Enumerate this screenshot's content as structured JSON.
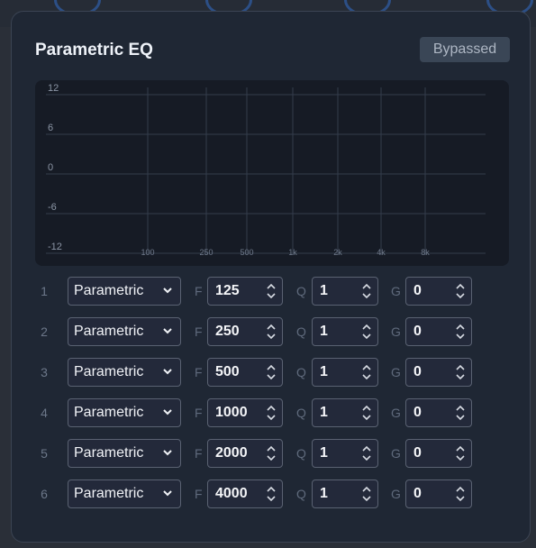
{
  "panel": {
    "title": "Parametric EQ",
    "bypass_label": "Bypassed"
  },
  "graph": {
    "gain_labels": [
      "12",
      "6",
      "0",
      "-6",
      "-12"
    ],
    "freq_labels": [
      "100",
      "250",
      "500",
      "1k",
      "2k",
      "4k",
      "8k"
    ]
  },
  "field_letters": {
    "freq": "F",
    "q": "Q",
    "gain": "G"
  },
  "bands": [
    {
      "number": "1",
      "type": "Parametric",
      "freq": "125",
      "q": "1",
      "gain": "0"
    },
    {
      "number": "2",
      "type": "Parametric",
      "freq": "250",
      "q": "1",
      "gain": "0"
    },
    {
      "number": "3",
      "type": "Parametric",
      "freq": "500",
      "q": "1",
      "gain": "0"
    },
    {
      "number": "4",
      "type": "Parametric",
      "freq": "1000",
      "q": "1",
      "gain": "0"
    },
    {
      "number": "5",
      "type": "Parametric",
      "freq": "2000",
      "q": "1",
      "gain": "0"
    },
    {
      "number": "6",
      "type": "Parametric",
      "freq": "4000",
      "q": "1",
      "gain": "0"
    }
  ],
  "icons": {
    "dropdown": "chevron-down-icon",
    "spinner": "up-down-spinner-icon"
  }
}
